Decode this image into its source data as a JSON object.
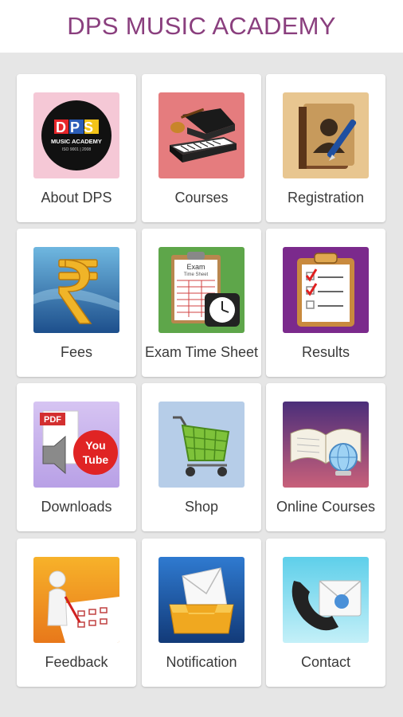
{
  "app": {
    "title": "DPS MUSIC ACADEMY"
  },
  "tiles": [
    {
      "label": "About DPS",
      "icon": "dps-logo-icon",
      "logo_text": "DPS",
      "logo_sub": "MUSIC ACADEMY",
      "logo_tag": "ISO 9001 | 2008"
    },
    {
      "label": "Courses",
      "icon": "piano-guitar-icon"
    },
    {
      "label": "Registration",
      "icon": "address-book-icon"
    },
    {
      "label": "Fees",
      "icon": "rupee-icon"
    },
    {
      "label": "Exam Time Sheet",
      "icon": "exam-clipboard-clock-icon",
      "sheet_title": "Exam",
      "sheet_sub": "Time Sheet"
    },
    {
      "label": "Results",
      "icon": "checklist-clipboard-icon"
    },
    {
      "label": "Downloads",
      "icon": "pdf-youtube-icon",
      "pdf_text": "PDF",
      "yt_you": "You",
      "yt_tube": "Tube"
    },
    {
      "label": "Shop",
      "icon": "shopping-cart-icon"
    },
    {
      "label": "Online Courses",
      "icon": "book-globe-icon"
    },
    {
      "label": "Feedback",
      "icon": "feedback-form-icon"
    },
    {
      "label": "Notification",
      "icon": "envelope-inbox-icon"
    },
    {
      "label": "Contact",
      "icon": "phone-mail-icon"
    }
  ]
}
